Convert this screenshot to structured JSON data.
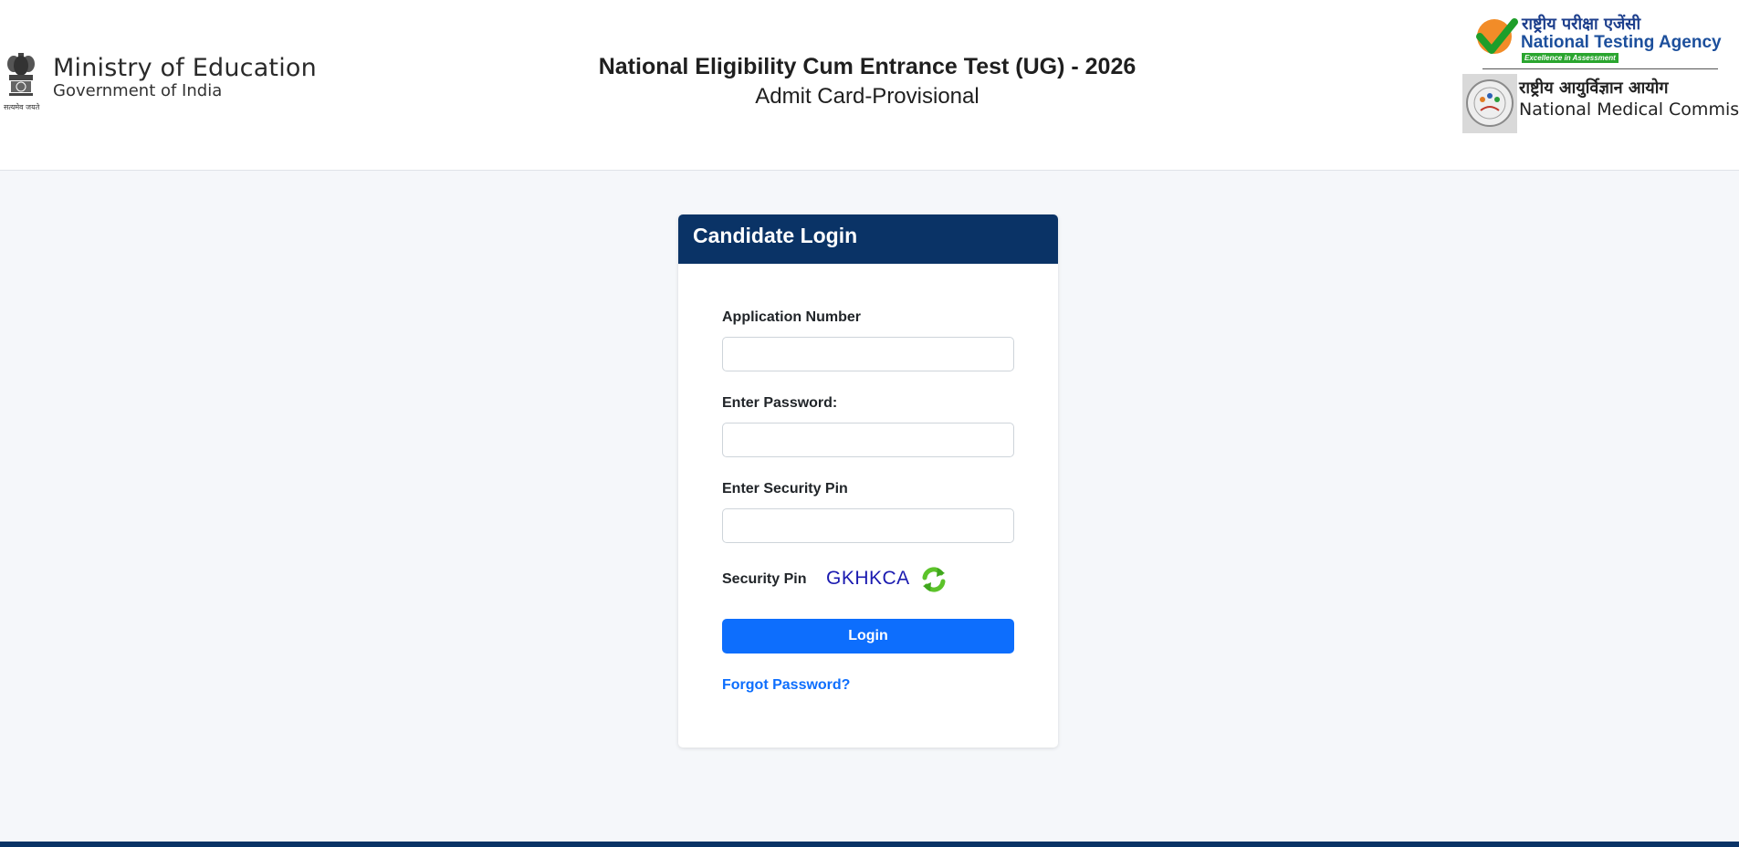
{
  "header": {
    "ministry_title": "Ministry of Education",
    "ministry_subtitle": "Government of India",
    "emblem_motto": "सत्यमेव जयते",
    "exam_title": "National Eligibility Cum Entrance Test (UG) - 2026",
    "exam_subtitle": "Admit Card-Provisional",
    "nta": {
      "hindi": "राष्ट्रीय परीक्षा एजेंसी",
      "english": "National Testing Agency",
      "tagline": "Excellence in Assessment"
    },
    "nmc": {
      "hindi": "राष्ट्रीय आयुर्विज्ञान आयोग",
      "english": "National Medical Commission"
    }
  },
  "login": {
    "card_title": "Candidate Login",
    "application_label": "Application Number",
    "application_value": "",
    "password_label": "Enter Password:",
    "password_value": "",
    "security_pin_label": "Enter Security Pin",
    "security_pin_value": "",
    "captcha_label": "Security Pin",
    "captcha_code": "GKHKCA",
    "refresh_icon": "refresh-icon",
    "login_button": "Login",
    "forgot_link": "Forgot Password?"
  },
  "colors": {
    "header_bg": "#ffffff",
    "page_bg": "#f5f7fa",
    "card_header": "#0a3366",
    "primary_button": "#0d6efd",
    "captcha_text": "#1a1ab0"
  }
}
